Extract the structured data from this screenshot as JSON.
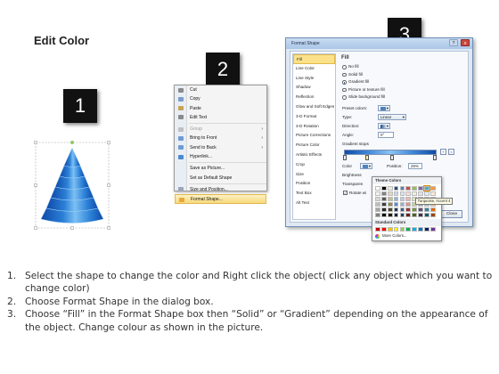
{
  "page": {
    "title": "Edit Color"
  },
  "badges": [
    "1",
    "2",
    "3"
  ],
  "context_menu": {
    "items": [
      {
        "label": "Cut",
        "icon": "scissors-icon",
        "color": "#8a8a8a"
      },
      {
        "label": "Copy",
        "icon": "copy-icon",
        "color": "#7a9cc9"
      },
      {
        "label": "Paste",
        "icon": "paste-icon",
        "color": "#c9a356"
      },
      {
        "label": "Edit Text",
        "icon": "edit-text-icon",
        "color": "#8a8a8a"
      },
      {
        "label": "Group",
        "icon": "group-icon",
        "color": "#bfbfbf",
        "disabled": true,
        "submenu": true
      },
      {
        "label": "Bring to Front",
        "icon": "bring-to-front-icon",
        "color": "#6f9bd3",
        "submenu": true
      },
      {
        "label": "Send to Back",
        "icon": "send-to-back-icon",
        "color": "#6f9bd3",
        "submenu": true
      },
      {
        "label": "Hyperlink...",
        "icon": "hyperlink-icon",
        "color": "#4b8ad1"
      },
      {
        "label": "Save as Picture...",
        "icon": "",
        "color": ""
      },
      {
        "label": "Set as Default Shape",
        "icon": "",
        "color": ""
      },
      {
        "label": "Size and Position...",
        "icon": "size-position-icon",
        "color": "#9aa6b5"
      },
      {
        "label": "Format Shape...",
        "icon": "format-shape-icon",
        "color": "#e6a93c",
        "selected": true
      }
    ]
  },
  "dialog": {
    "title": "Format Shape",
    "help": "?",
    "close": "x",
    "categories": [
      "Fill",
      "Line Color",
      "Line Style",
      "Shadow",
      "Reflection",
      "Glow and Soft Edges",
      "3-D Format",
      "3-D Rotation",
      "Picture Corrections",
      "Picture Color",
      "Artistic Effects",
      "Crop",
      "Size",
      "Position",
      "Text Box",
      "Alt Text"
    ],
    "active_category": "Fill",
    "section_head": "Fill",
    "fill_options": [
      {
        "label": "No fill",
        "on": false
      },
      {
        "label": "Solid fill",
        "on": false
      },
      {
        "label": "Gradient fill",
        "on": true
      },
      {
        "label": "Picture or texture fill",
        "on": false
      },
      {
        "label": "Slide background fill",
        "on": false
      }
    ],
    "preset_colors_label": "Preset colors:",
    "type_label": "Type:",
    "type_value": "Linear",
    "direction_label": "Direction:",
    "angle_label": "Angle:",
    "angle_value": "0°",
    "gradient_stops_label": "Gradient stops",
    "color_label": "Color",
    "position_label": "Position:",
    "position_value": "25%",
    "brightness_label": "Brightness",
    "transparency_label": "Transparen",
    "rotate_label": "Rotate wi",
    "close_button": "Close"
  },
  "palette": {
    "theme_head": "Theme Colors",
    "standard_head": "Standard Colors",
    "more_label": "More Colors...",
    "tooltip": "Turquoise, Accent 4",
    "theme_colors": [
      [
        "#ffffff",
        "#000000",
        "#eeece1",
        "#1f497d",
        "#4f81bd",
        "#c0504d",
        "#9bbb59",
        "#8064a2",
        "#4bacc6",
        "#f79646"
      ],
      [
        "#f2f2f2",
        "#7f7f7f",
        "#ddd9c3",
        "#c6d9f0",
        "#dbe5f1",
        "#f2dcdb",
        "#ebf1dd",
        "#e5e0ec",
        "#dbeef3",
        "#fdeada"
      ],
      [
        "#d8d8d8",
        "#595959",
        "#c4bd97",
        "#8db3e2",
        "#b8cce4",
        "#e5b9b7",
        "#d7e3bc",
        "#ccc1d9",
        "#b7dde8",
        "#fbd5b5"
      ],
      [
        "#bfbfbf",
        "#3f3f3f",
        "#938953",
        "#548dd4",
        "#95b3d7",
        "#d99694",
        "#c3d69b",
        "#b2a2c7",
        "#92cddc",
        "#fac08f"
      ],
      [
        "#a5a5a5",
        "#262626",
        "#494429",
        "#17365d",
        "#366092",
        "#953734",
        "#76923c",
        "#5f497a",
        "#31859b",
        "#e36c09"
      ],
      [
        "#7f7f7f",
        "#0c0c0c",
        "#1d1b10",
        "#0f243e",
        "#244061",
        "#632423",
        "#4f6128",
        "#3f3151",
        "#205867",
        "#974806"
      ]
    ],
    "standard_colors": [
      "#c00000",
      "#ff0000",
      "#ffc000",
      "#ffff00",
      "#92d050",
      "#00b050",
      "#00b0f0",
      "#0070c0",
      "#002060",
      "#7030a0"
    ]
  },
  "instructions": [
    {
      "num": "1.",
      "text": "Select the shape to change the color and Right click the object( click any object which you want to change color)"
    },
    {
      "num": "2.",
      "text": "Choose Format Shape in the dialog box."
    },
    {
      "num": "3.",
      "text": "Choose “Fill” in the Format Shape box then “Solid” or “Gradient” depending on the appearance of the object. Change colour as shown in the picture."
    }
  ],
  "colors": {
    "badge": "#111111",
    "cone_dark": "#0f4aa8",
    "cone_light": "#7cc0f4",
    "menu_highlight": "#f7d97a",
    "dialog_frame": "#6f8fb5"
  }
}
